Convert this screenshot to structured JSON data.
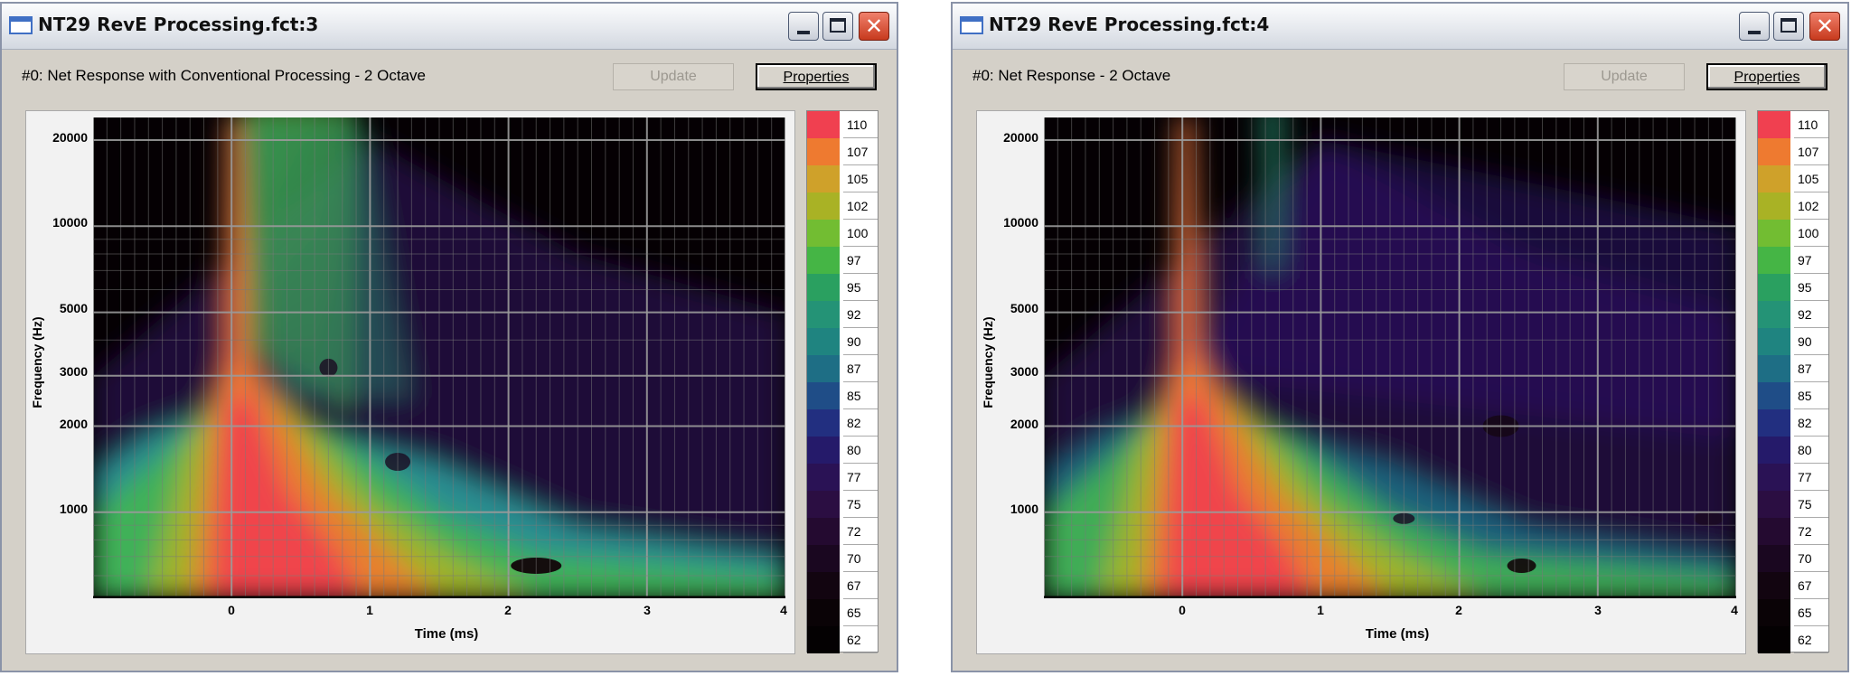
{
  "colors": {
    "colorbar": [
      "#f03c4b",
      "#ed7d2d",
      "#cba825",
      "#a3b224",
      "#5ebd3d",
      "#3aa84e",
      "#2a9a6a",
      "#238a7a",
      "#1e7a7c",
      "#1c5a84",
      "#213c82",
      "#241f72",
      "#2a1554",
      "#2d0f3f",
      "#250a23",
      "#150306",
      "#050000"
    ]
  },
  "windows": [
    {
      "title": "NT29 RevE Processing.fct:3",
      "caption": "#0: Net Response with Conventional Processing - 2 Octave",
      "update_label": "Update",
      "properties_label": "Properties",
      "chart": {
        "ylabel": "Frequency (Hz)",
        "xlabel": "Time (ms)",
        "yticks": [
          "20000",
          "10000",
          "5000",
          "3000",
          "2000",
          "1000"
        ],
        "xticks": [
          "0",
          "1",
          "2",
          "3",
          "4"
        ],
        "colorbar": [
          "110",
          "107",
          "105",
          "102",
          "100",
          "97",
          "95",
          "92",
          "90",
          "87",
          "85",
          "82",
          "80",
          "77",
          "75",
          "72",
          "70",
          "67",
          "65",
          "62"
        ]
      }
    },
    {
      "title": "NT29 RevE Processing.fct:4",
      "caption": "#0: Net Response - 2 Octave",
      "update_label": "Update",
      "properties_label": "Properties",
      "chart": {
        "ylabel": "Frequency (Hz)",
        "xlabel": "Time (ms)",
        "yticks": [
          "20000",
          "10000",
          "5000",
          "3000",
          "2000",
          "1000"
        ],
        "xticks": [
          "0",
          "1",
          "2",
          "3",
          "4"
        ],
        "colorbar": [
          "110",
          "107",
          "105",
          "102",
          "100",
          "97",
          "95",
          "92",
          "90",
          "87",
          "85",
          "82",
          "80",
          "77",
          "75",
          "72",
          "70",
          "67",
          "65",
          "62"
        ]
      }
    }
  ],
  "chart_data": [
    {
      "type": "heatmap",
      "title": "#0: Net Response with Conventional Processing - 2 Octave",
      "xlabel": "Time (ms)",
      "ylabel": "Frequency (Hz)",
      "xlim": [
        -1,
        4
      ],
      "ylim": [
        500,
        24000
      ],
      "yscale": "log",
      "yticks": [
        1000,
        2000,
        3000,
        5000,
        10000,
        20000
      ],
      "xticks": [
        0,
        1,
        2,
        3,
        4
      ],
      "colorbar_values": [
        110,
        107,
        105,
        102,
        100,
        97,
        95,
        92,
        90,
        87,
        85,
        82,
        80,
        77,
        75,
        72,
        70,
        67,
        65,
        62
      ],
      "grid": true,
      "variant": "conventional"
    },
    {
      "type": "heatmap",
      "title": "#0: Net Response - 2 Octave",
      "xlabel": "Time (ms)",
      "ylabel": "Frequency (Hz)",
      "xlim": [
        -1,
        4
      ],
      "ylim": [
        500,
        24000
      ],
      "yscale": "log",
      "yticks": [
        1000,
        2000,
        3000,
        5000,
        10000,
        20000
      ],
      "xticks": [
        0,
        1,
        2,
        3,
        4
      ],
      "colorbar_values": [
        110,
        107,
        105,
        102,
        100,
        97,
        95,
        92,
        90,
        87,
        85,
        82,
        80,
        77,
        75,
        72,
        70,
        67,
        65,
        62
      ],
      "grid": true,
      "variant": "net"
    }
  ]
}
